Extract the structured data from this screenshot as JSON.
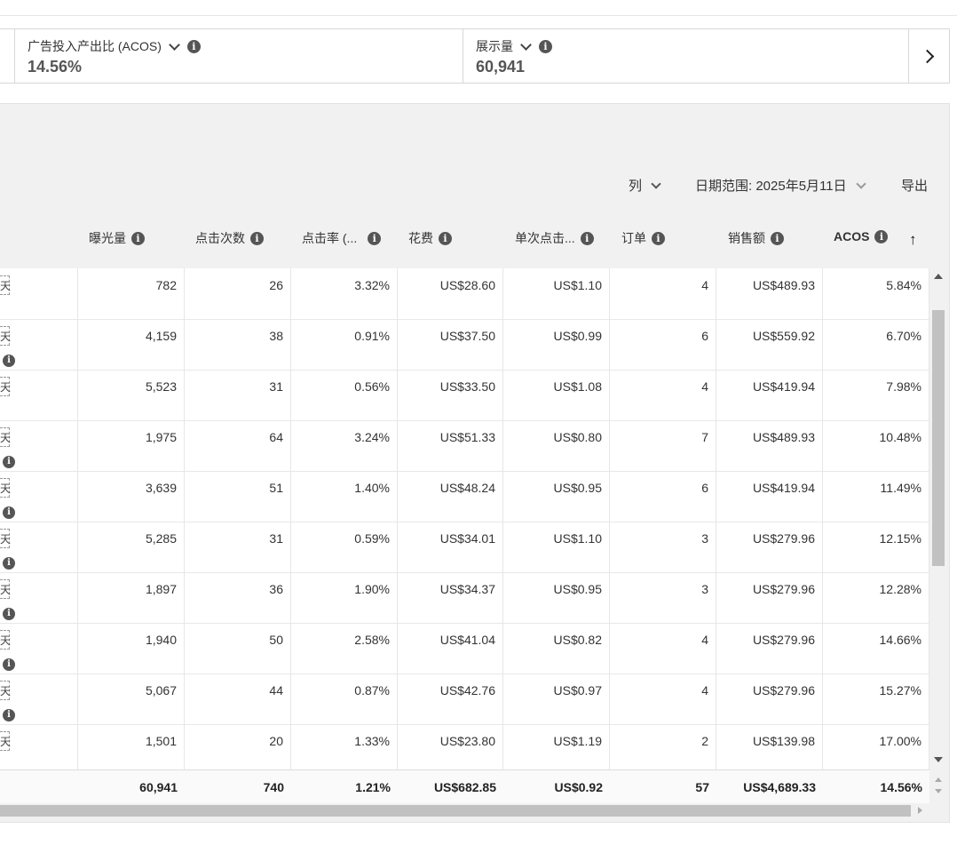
{
  "metrics": {
    "acos": {
      "label": "广告投入产出比 (ACOS)",
      "value": "14.56%"
    },
    "impressions": {
      "label": "展示量",
      "value": "60,941"
    }
  },
  "toolbar": {
    "columns_label": "列",
    "date_range_label": "日期范围: 2025年5月11日",
    "export_label": "导出"
  },
  "table": {
    "headers": [
      "曝光量",
      "点击次数",
      "点击率 (...",
      "花费",
      "单次点击...",
      "订单",
      "销售额",
      "ACOS"
    ],
    "stub_text": "天",
    "rows": [
      {
        "cells": [
          "782",
          "26",
          "3.32%",
          "US$28.60",
          "US$1.10",
          "4",
          "US$489.93",
          "5.84%"
        ],
        "stub_info": false
      },
      {
        "cells": [
          "4,159",
          "38",
          "0.91%",
          "US$37.50",
          "US$0.99",
          "6",
          "US$559.92",
          "6.70%"
        ],
        "stub_info": true
      },
      {
        "cells": [
          "5,523",
          "31",
          "0.56%",
          "US$33.50",
          "US$1.08",
          "4",
          "US$419.94",
          "7.98%"
        ],
        "stub_info": false
      },
      {
        "cells": [
          "1,975",
          "64",
          "3.24%",
          "US$51.33",
          "US$0.80",
          "7",
          "US$489.93",
          "10.48%"
        ],
        "stub_info": true
      },
      {
        "cells": [
          "3,639",
          "51",
          "1.40%",
          "US$48.24",
          "US$0.95",
          "6",
          "US$419.94",
          "11.49%"
        ],
        "stub_info": true
      },
      {
        "cells": [
          "5,285",
          "31",
          "0.59%",
          "US$34.01",
          "US$1.10",
          "3",
          "US$279.96",
          "12.15%"
        ],
        "stub_info": true
      },
      {
        "cells": [
          "1,897",
          "36",
          "1.90%",
          "US$34.37",
          "US$0.95",
          "3",
          "US$279.96",
          "12.28%"
        ],
        "stub_info": true
      },
      {
        "cells": [
          "1,940",
          "50",
          "2.58%",
          "US$41.04",
          "US$0.82",
          "4",
          "US$279.96",
          "14.66%"
        ],
        "stub_info": true
      },
      {
        "cells": [
          "5,067",
          "44",
          "0.87%",
          "US$42.76",
          "US$0.97",
          "4",
          "US$279.96",
          "15.27%"
        ],
        "stub_info": true
      },
      {
        "cells": [
          "1,501",
          "20",
          "1.33%",
          "US$23.80",
          "US$1.19",
          "2",
          "US$139.98",
          "17.00%"
        ],
        "stub_info": false
      }
    ],
    "totals": [
      "60,941",
      "740",
      "1.21%",
      "US$682.85",
      "US$0.92",
      "57",
      "US$4,689.33",
      "14.56%"
    ]
  }
}
